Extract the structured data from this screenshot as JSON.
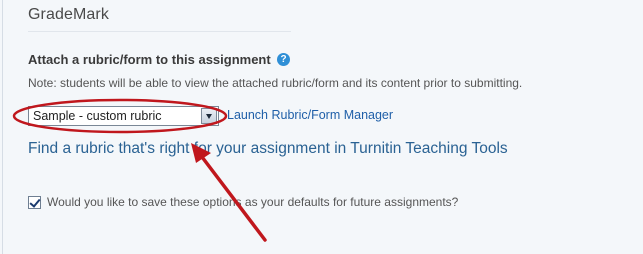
{
  "section": {
    "title": "GradeMark"
  },
  "rubric": {
    "heading": "Attach a rubric/form to this assignment",
    "help_icon": "question-icon",
    "help_glyph": "?",
    "note": "Note: students will be able to view the attached rubric/form and its content prior to submitting.",
    "selected_value": "Sample - custom rubric",
    "launch_link": "Launch Rubric/Form Manager",
    "find_link": "Find a rubric that's right for your assignment in Turnitin Teaching Tools"
  },
  "defaults": {
    "checked": true,
    "label": "Would you like to save these options as your defaults for future assignments?"
  },
  "colors": {
    "background": "#f4f7fa",
    "link": "#1f5fa8",
    "help_icon": "#2f8fd6",
    "annotation": "#c0171d"
  },
  "annotation": {
    "shapes": [
      "ellipse-highlight",
      "arrow"
    ]
  }
}
